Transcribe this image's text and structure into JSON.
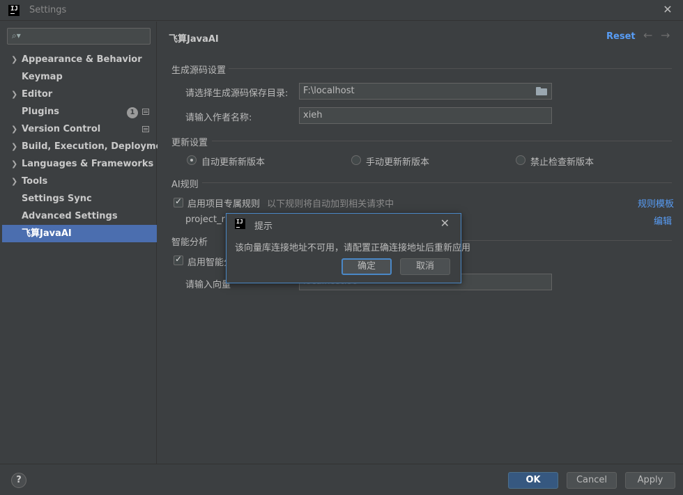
{
  "window": {
    "title": "Settings"
  },
  "sidebar": {
    "search_placeholder": "",
    "items": [
      {
        "label": "Appearance & Behavior",
        "expandable": true
      },
      {
        "label": "Keymap",
        "expandable": false
      },
      {
        "label": "Editor",
        "expandable": true
      },
      {
        "label": "Plugins",
        "expandable": false,
        "badge": "1"
      },
      {
        "label": "Version Control",
        "expandable": true
      },
      {
        "label": "Build, Execution, Deployment",
        "expandable": true
      },
      {
        "label": "Languages & Frameworks",
        "expandable": true
      },
      {
        "label": "Tools",
        "expandable": true
      },
      {
        "label": "Settings Sync",
        "expandable": false
      },
      {
        "label": "Advanced Settings",
        "expandable": false
      },
      {
        "label": "飞算JavaAI",
        "expandable": false,
        "selected": true
      }
    ]
  },
  "main": {
    "title": "飞算JavaAI",
    "reset_label": "Reset",
    "source_section": {
      "header": "生成源码设置",
      "path_label": "请选择生成源码保存目录:",
      "path_value": "F:\\localhost",
      "author_label": "请输入作者名称:",
      "author_value": "xieh"
    },
    "update_section": {
      "header": "更新设置",
      "options": [
        {
          "label": "自动更新新版本",
          "checked": true
        },
        {
          "label": "手动更新新版本",
          "checked": false
        },
        {
          "label": "禁止检查新版本",
          "checked": false
        }
      ]
    },
    "ai_rules_section": {
      "header": "AI规则",
      "enable_label": "启用项目专属规则",
      "enable_checked": true,
      "hint": "以下规则将自动加到相关请求中",
      "template_link": "规则模板",
      "rule_name": "project_ru",
      "edit_link": "编辑"
    },
    "smart_section": {
      "header": "智能分析",
      "enable_label": "启用智能分",
      "enable_checked": true,
      "vector_label": "请输入向量",
      "vector_value": "localhost:99"
    }
  },
  "dialog": {
    "title": "提示",
    "message": "该向量库连接地址不可用，请配置正确连接地址后重新应用",
    "ok_label": "确定",
    "cancel_label": "取消"
  },
  "footer": {
    "help_label": "?",
    "ok_label": "OK",
    "cancel_label": "Cancel",
    "apply_label": "Apply"
  },
  "colors": {
    "background": "#3c3f41",
    "selection": "#4b6eaf",
    "link": "#589df6",
    "primary_button": "#365880"
  }
}
